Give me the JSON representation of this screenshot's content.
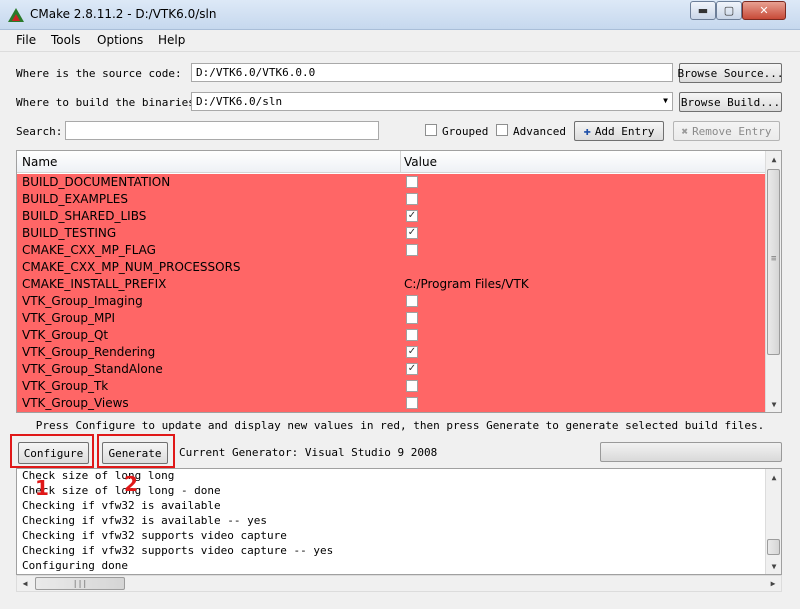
{
  "window": {
    "title": "CMake 2.8.11.2 - D:/VTK6.0/sln",
    "min": "▬",
    "max": "▢",
    "close": "✕"
  },
  "menu": [
    "File",
    "Tools",
    "Options",
    "Help"
  ],
  "source": {
    "label": "Where is the source code:",
    "value": "D:/VTK6.0/VTK6.0.0",
    "button": "Browse Source..."
  },
  "build": {
    "label": "Where to build the binaries:",
    "value": "D:/VTK6.0/sln",
    "button": "Browse Build..."
  },
  "search": {
    "label": "Search:",
    "value": ""
  },
  "options": {
    "grouped": "Grouped",
    "advanced": "Advanced",
    "add_entry": "Add Entry",
    "remove_entry": "Remove Entry"
  },
  "table": {
    "headers": [
      "Name",
      "Value"
    ],
    "rows": [
      {
        "name": "BUILD_DOCUMENTATION",
        "type": "bool",
        "checked": false
      },
      {
        "name": "BUILD_EXAMPLES",
        "type": "bool",
        "checked": false
      },
      {
        "name": "BUILD_SHARED_LIBS",
        "type": "bool",
        "checked": true
      },
      {
        "name": "BUILD_TESTING",
        "type": "bool",
        "checked": true
      },
      {
        "name": "CMAKE_CXX_MP_FLAG",
        "type": "bool",
        "checked": false
      },
      {
        "name": "CMAKE_CXX_MP_NUM_PROCESSORS",
        "type": "text",
        "value": ""
      },
      {
        "name": "CMAKE_INSTALL_PREFIX",
        "type": "text",
        "value": "C:/Program Files/VTK"
      },
      {
        "name": "VTK_Group_Imaging",
        "type": "bool",
        "checked": false
      },
      {
        "name": "VTK_Group_MPI",
        "type": "bool",
        "checked": false
      },
      {
        "name": "VTK_Group_Qt",
        "type": "bool",
        "checked": false
      },
      {
        "name": "VTK_Group_Rendering",
        "type": "bool",
        "checked": true
      },
      {
        "name": "VTK_Group_StandAlone",
        "type": "bool",
        "checked": true
      },
      {
        "name": "VTK_Group_Tk",
        "type": "bool",
        "checked": false
      },
      {
        "name": "VTK_Group_Views",
        "type": "bool",
        "checked": false
      }
    ]
  },
  "hint": "Press Configure to update and display new values in red, then press Generate to generate selected build files.",
  "actions": {
    "configure": "Configure",
    "generate": "Generate",
    "generator": "Current Generator: Visual Studio 9 2008"
  },
  "annotations": {
    "one": "1",
    "two": "2",
    "color": "#e01818"
  },
  "row_color": "#ff6666",
  "log": [
    "Check size of long long",
    "Check size of long long - done",
    "Checking if vfw32 is available",
    "Checking if vfw32 is available -- yes",
    "Checking if vfw32 supports video capture",
    "Checking if vfw32 supports video capture -- yes",
    "Configuring done"
  ],
  "glyphs": {
    "up": "▲",
    "down": "▼",
    "left": "◀",
    "right": "▶",
    "grip": "≡",
    "grip_h": "|||",
    "check": "✓",
    "plus": "✚",
    "cross": "✖",
    "dropdown": "▼"
  }
}
